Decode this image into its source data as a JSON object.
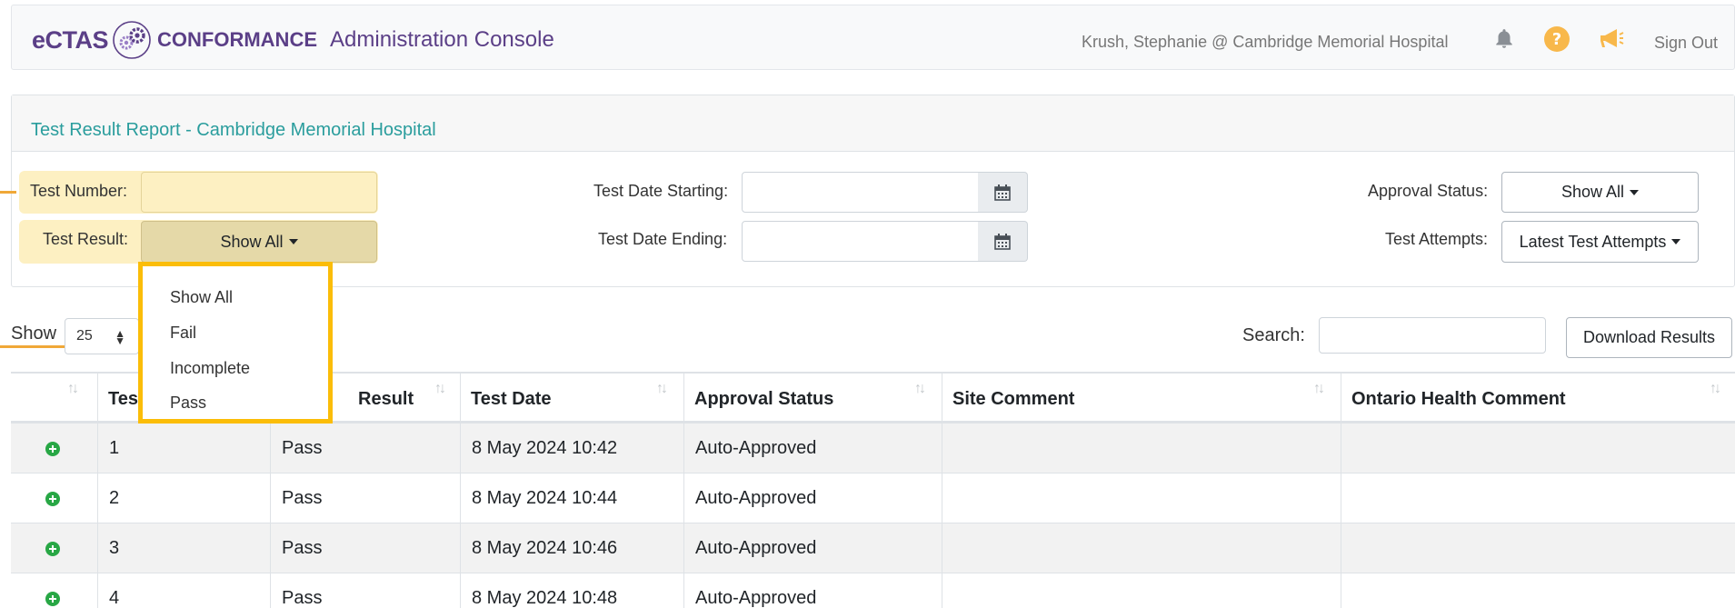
{
  "header": {
    "brand_ectas": "eCTAS",
    "brand_conformance": "CONFORMANCE",
    "console_title": "Administration Console",
    "user": "Krush, Stephanie @ Cambridge Memorial Hospital",
    "sign_out": "Sign Out",
    "icons": [
      "bell-icon",
      "help-icon",
      "megaphone-icon"
    ],
    "brand_color": "#5b3f87"
  },
  "report": {
    "title": "Test Result Report - Cambridge Memorial Hospital",
    "title_color": "#2a9d9d"
  },
  "filters": {
    "test_number_label": "Test Number:",
    "test_number_value": "",
    "test_result_label": "Test Result:",
    "test_result_value": "Show All",
    "date_start_label": "Test Date Starting:",
    "date_start_value": "",
    "date_end_label": "Test Date Ending:",
    "date_end_value": "",
    "approval_status_label": "Approval Status:",
    "approval_status_value": "Show All",
    "test_attempts_label": "Test Attempts:",
    "test_attempts_value": "Latest Test Attempts"
  },
  "test_result_dropdown": {
    "options": [
      "Show All",
      "Fail",
      "Incomplete",
      "Pass"
    ],
    "highlight_color": "#fbbd08"
  },
  "table_controls": {
    "show_label": "Show",
    "page_size": "25",
    "search_label": "Search:",
    "search_value": "",
    "download_label": "Download Results"
  },
  "table": {
    "columns": [
      "",
      "Test Number",
      "Test Result",
      "Test Date",
      "Approval Status",
      "Site Comment",
      "Ontario Health Comment"
    ],
    "visible_column_text": [
      "",
      "Tes",
      "Result",
      "Test Date",
      "Approval Status",
      "Site Comment",
      "Ontario Health Comment"
    ],
    "rows": [
      {
        "number": "1",
        "result": "Pass",
        "date": "8 May 2024 10:42",
        "approval": "Auto-Approved",
        "site_comment": "",
        "oh_comment": ""
      },
      {
        "number": "2",
        "result": "Pass",
        "date": "8 May 2024 10:44",
        "approval": "Auto-Approved",
        "site_comment": "",
        "oh_comment": ""
      },
      {
        "number": "3",
        "result": "Pass",
        "date": "8 May 2024 10:46",
        "approval": "Auto-Approved",
        "site_comment": "",
        "oh_comment": ""
      },
      {
        "number": "4",
        "result": "Pass",
        "date": "8 May 2024 10:48",
        "approval": "Auto-Approved",
        "site_comment": "",
        "oh_comment": ""
      }
    ]
  }
}
